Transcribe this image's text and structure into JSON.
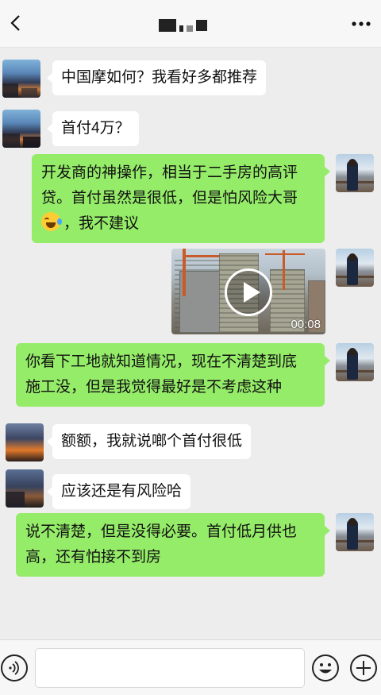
{
  "header": {
    "title_obscured": true,
    "back_icon": "chevron-left-icon",
    "more_icon": "more-dots-icon"
  },
  "messages": [
    {
      "side": "left",
      "text": "中国摩如何？我看好多都推荐"
    },
    {
      "side": "left",
      "text": "首付4万？"
    },
    {
      "side": "right",
      "text_lines": [
        "开发商的神操作，相当于二手房的高评",
        "贷。首付虽然是很低，但是怕风险大哥"
      ],
      "emoji": "laughing-tears-emoji",
      "text_tail": "，我不建议"
    },
    {
      "side": "right",
      "type": "video",
      "duration": "00:08"
    },
    {
      "side": "right",
      "text_lines": [
        "你看下工地就知道情况，现在不清楚到底",
        "施工没，但是我觉得最好是不考虑这种"
      ]
    },
    {
      "side": "left",
      "text": "额额，我就说啷个首付很低"
    },
    {
      "side": "left",
      "text": "应该还是有风险哈"
    },
    {
      "side": "right",
      "text_lines": [
        "说不清楚，但是没得必要。首付低月供也",
        "高，还有怕接不到房"
      ]
    }
  ],
  "input_bar": {
    "voice_icon": "voice-icon",
    "emoji_icon": "smiley-icon",
    "plus_icon": "plus-icon",
    "input_value": ""
  },
  "colors": {
    "sent_bubble": "#95ec69",
    "received_bubble": "#ffffff",
    "background": "#ededed"
  }
}
